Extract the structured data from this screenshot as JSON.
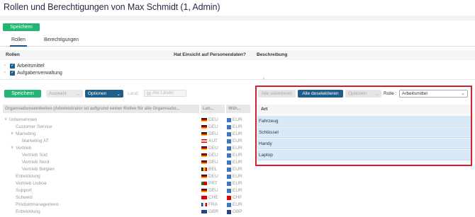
{
  "page": {
    "title": "Rollen und Berechtigungen von Max Schmidt (1, Admin)",
    "save_label": "Speichern"
  },
  "tabs": [
    {
      "label": "Rollen",
      "active": true
    },
    {
      "label": "Berechtigungen",
      "active": false
    }
  ],
  "roles_table": {
    "headers": [
      "Rollen",
      "Hat Einsicht auf Personendaten?",
      "Beschreibung"
    ],
    "rows": [
      {
        "label": "Arbeitsmittel",
        "checked": true
      },
      {
        "label": "Aufgabenverwaltung",
        "checked": true
      }
    ]
  },
  "left_toolbar": {
    "save_label": "Speichern",
    "auswahl_label": "Auswahl",
    "optionen_label": "Optionen",
    "land_label": "Land:",
    "land_placeholder": "Alle Länder"
  },
  "org_table": {
    "headers": [
      "Organisationseinheiten (Administrator ist aufgrund seiner Rollen für alle Organisatio...",
      "Lan...",
      "Wäh..."
    ],
    "rows": [
      {
        "name": "Unternehmen",
        "indent": 0,
        "expand": "∨",
        "country": "DEU",
        "currency": "EUR",
        "flag": "de"
      },
      {
        "name": "Customer Service",
        "indent": 1,
        "expand": "",
        "country": "DEU",
        "currency": "EUR",
        "flag": "de"
      },
      {
        "name": "Marketing",
        "indent": 1,
        "expand": "∨",
        "country": "DEU",
        "currency": "EUR",
        "flag": "de"
      },
      {
        "name": "Marketing AT",
        "indent": 2,
        "expand": "",
        "country": "AUT",
        "currency": "EUR",
        "flag": "at"
      },
      {
        "name": "Vertrieb",
        "indent": 1,
        "expand": "∨",
        "country": "DEU",
        "currency": "EUR",
        "flag": "de"
      },
      {
        "name": "Vertrieb Süd",
        "indent": 2,
        "expand": "",
        "country": "DEU",
        "currency": "EUR",
        "flag": "de"
      },
      {
        "name": "Vertrieb Nord",
        "indent": 2,
        "expand": "",
        "country": "DEU",
        "currency": "EUR",
        "flag": "de"
      },
      {
        "name": "Vertrieb Belgien",
        "indent": 2,
        "expand": "",
        "country": "BEL",
        "currency": "EUR",
        "flag": "be"
      },
      {
        "name": "Entwicklung",
        "indent": 1,
        "expand": "",
        "country": "DEU",
        "currency": "EUR",
        "flag": "de"
      },
      {
        "name": "Vertrieb Lisboa",
        "indent": 1,
        "expand": "",
        "country": "PRT",
        "currency": "EUR",
        "flag": "pt"
      },
      {
        "name": "Support",
        "indent": 1,
        "expand": "",
        "country": "DEU",
        "currency": "EUR",
        "flag": "de"
      },
      {
        "name": "Schweiz",
        "indent": 1,
        "expand": "",
        "country": "CHE",
        "currency": "CHF",
        "flag": "ch"
      },
      {
        "name": "Produktmanagement",
        "indent": 1,
        "expand": "",
        "country": "FRA",
        "currency": "EUR",
        "flag": "fr"
      },
      {
        "name": "Entwicklung",
        "indent": 1,
        "expand": "",
        "country": "GBR",
        "currency": "GBP",
        "flag": "gb"
      }
    ]
  },
  "right_panel": {
    "select_all_label": "Alle selektieren",
    "deselect_all_label": "Alle deselektieren",
    "optionen_label": "Optionen",
    "rolle_label": "Rolle :",
    "rolle_value": "Arbeitsmittel",
    "column_header": "Art",
    "items": [
      "Fahrzeug",
      "Schlüssel",
      "Handy",
      "Laptop"
    ]
  },
  "colors": {
    "accent_green": "#22b573",
    "accent_blue": "#1f5d8a",
    "highlight_red": "#d3202a",
    "selected_row": "#d8eaf8"
  }
}
